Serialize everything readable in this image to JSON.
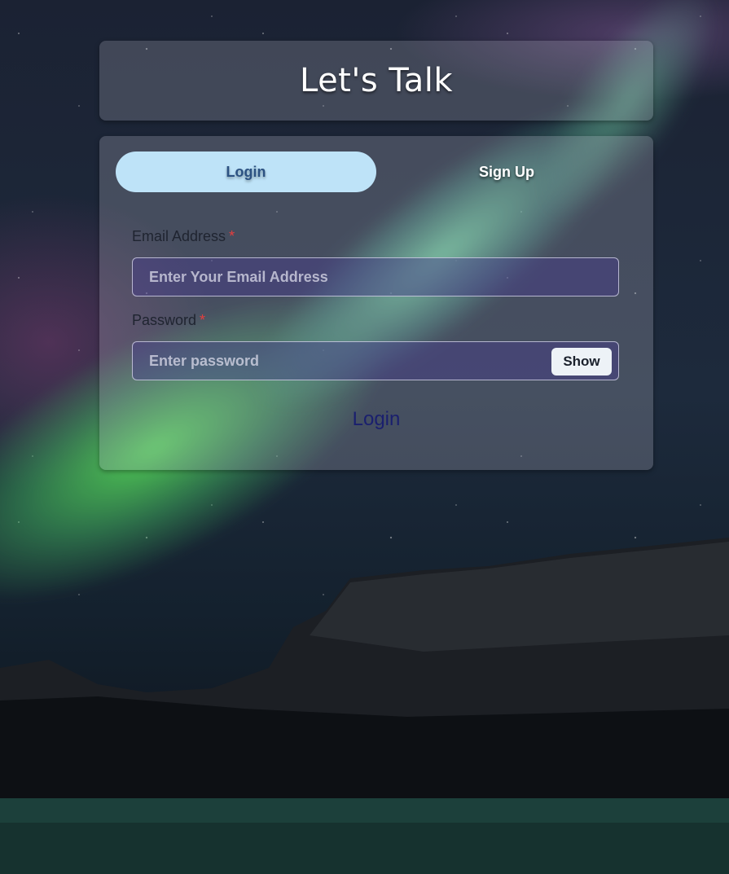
{
  "header": {
    "title": "Let's Talk"
  },
  "tabs": [
    {
      "label": "Login",
      "active": true
    },
    {
      "label": "Sign Up",
      "active": false
    }
  ],
  "form": {
    "email": {
      "label": "Email Address",
      "required_mark": "*",
      "placeholder": "Enter Your Email Address",
      "value": ""
    },
    "password": {
      "label": "Password",
      "required_mark": "*",
      "placeholder": "Enter password",
      "value": "",
      "toggle_label": "Show"
    },
    "submit_label": "Login"
  },
  "colors": {
    "active_tab_bg": "#bee3f8",
    "active_tab_text": "#2c5282",
    "required": "#e53e3e",
    "submit_text": "#1a1f6e"
  },
  "background": {
    "scene": "aurora-over-mountains"
  }
}
